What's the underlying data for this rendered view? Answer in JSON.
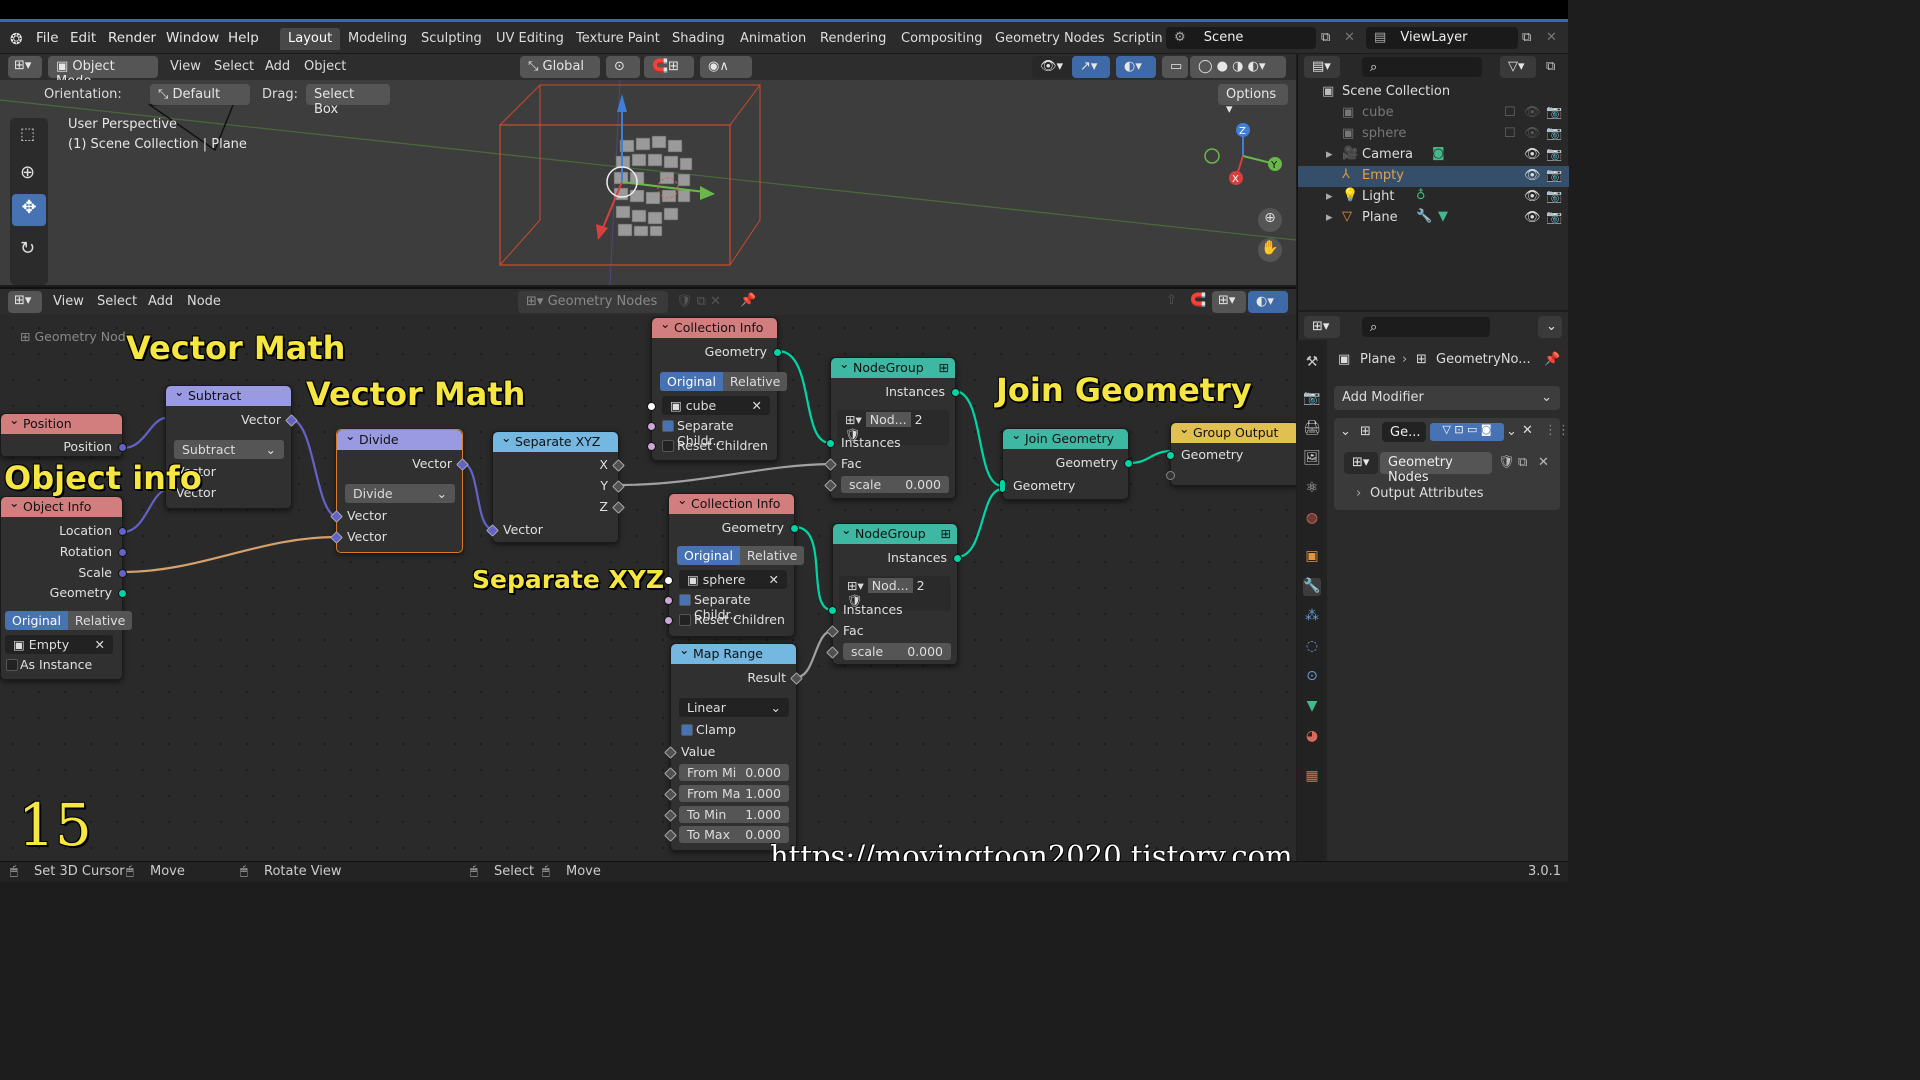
{
  "menubar": {
    "items": [
      "File",
      "Edit",
      "Render",
      "Window",
      "Help"
    ],
    "workspaces": [
      "Layout",
      "Modeling",
      "Sculpting",
      "UV Editing",
      "Texture Paint",
      "Shading",
      "Animation",
      "Rendering",
      "Compositing",
      "Geometry Nodes",
      "Scriptin"
    ],
    "active_workspace": "Layout",
    "scene": "Scene",
    "view_layer": "ViewLayer"
  },
  "viewport": {
    "mode": "Object Mode",
    "menus": [
      "View",
      "Select",
      "Add",
      "Object"
    ],
    "transform": "Global",
    "orientation_label": "Orientation:",
    "orientation_value": "Default",
    "drag_label": "Drag:",
    "drag_value": "Select Box",
    "options": "Options",
    "info_line1": "User Perspective",
    "info_line2": "(1) Scene Collection | Plane"
  },
  "outliner": {
    "root": "Scene Collection",
    "items": [
      {
        "name": "cube",
        "state": "disabled"
      },
      {
        "name": "sphere",
        "state": "disabled"
      },
      {
        "name": "Camera",
        "state": "normal"
      },
      {
        "name": "Empty",
        "state": "selected"
      },
      {
        "name": "Light",
        "state": "normal"
      },
      {
        "name": "Plane",
        "state": "normal"
      }
    ]
  },
  "node_editor": {
    "menus": [
      "View",
      "Select",
      "Add",
      "Node"
    ],
    "tree_name": "Geometry Nodes",
    "breadcrumb": "Geometry Nod",
    "nodes": {
      "position": {
        "title": "Position",
        "out": "Position"
      },
      "object_info": {
        "title": "Object Info",
        "outs": [
          "Location",
          "Rotation",
          "Scale",
          "Geometry"
        ],
        "mode_a": "Original",
        "mode_b": "Relative",
        "object": "Empty",
        "as_instance": "As Instance"
      },
      "subtract": {
        "title": "Subtract",
        "out": "Vector",
        "op": "Subtract",
        "in1": "Vector",
        "in2": "Vector"
      },
      "divide": {
        "title": "Divide",
        "out": "Vector",
        "op": "Divide",
        "in1": "Vector",
        "in2": "Vector"
      },
      "separate": {
        "title": "Separate XYZ",
        "outs": [
          "X",
          "Y",
          "Z"
        ],
        "in": "Vector"
      },
      "coll1": {
        "title": "Collection Info",
        "out": "Geometry",
        "mode_a": "Original",
        "mode_b": "Relative",
        "collection": "cube",
        "sep": "Separate Childr...",
        "reset": "Reset Children"
      },
      "coll2": {
        "title": "Collection Info",
        "out": "Geometry",
        "mode_a": "Original",
        "mode_b": "Relative",
        "collection": "sphere",
        "sep": "Separate Childr...",
        "reset": "Reset Children"
      },
      "map_range": {
        "title": "Map Range",
        "out": "Result",
        "interp": "Linear",
        "clamp": "Clamp",
        "in": "Value",
        "fields": [
          {
            "label": "From Mi",
            "value": "0.000"
          },
          {
            "label": "From Ma",
            "value": "1.000"
          },
          {
            "label": "To Min",
            "value": "1.000"
          },
          {
            "label": "To Max",
            "value": "0.000"
          }
        ]
      },
      "ng1": {
        "title": "NodeGroup",
        "out": "Instances",
        "group": "Nod...",
        "users": "2",
        "in1": "Instances",
        "in2": "Fac",
        "field_label": "scale",
        "field_value": "0.000"
      },
      "ng2": {
        "title": "NodeGroup",
        "out": "Instances",
        "group": "Nod...",
        "users": "2",
        "in1": "Instances",
        "in2": "Fac",
        "field_label": "scale",
        "field_value": "0.000"
      },
      "join": {
        "title": "Join Geometry",
        "out": "Geometry",
        "in": "Geometry"
      },
      "output": {
        "title": "Group Output",
        "in": "Geometry"
      }
    }
  },
  "annotations": {
    "vm1": "Vector Math",
    "vm2": "Vector Math",
    "obj": "Object info",
    "sep": "Separate XYZ",
    "join": "Join Geometry",
    "num": "15",
    "url": "https://movingtoon2020.tistory.com"
  },
  "properties": {
    "object": "Plane",
    "modifier_path": "GeometryNo...",
    "add_modifier": "Add Modifier",
    "mod_name": "Ge...",
    "node_group": "Geometry Nodes",
    "output_attr": "Output Attributes"
  },
  "statusbar": {
    "items": [
      "Set 3D Cursor",
      "Move",
      "Rotate View",
      "Select",
      "Move"
    ],
    "version": "3.0.1"
  },
  "colors": {
    "accent": "#4772b3",
    "geometry_socket": "#00d6a3",
    "vector_socket": "#6363c7",
    "annotation": "#f5e642"
  }
}
